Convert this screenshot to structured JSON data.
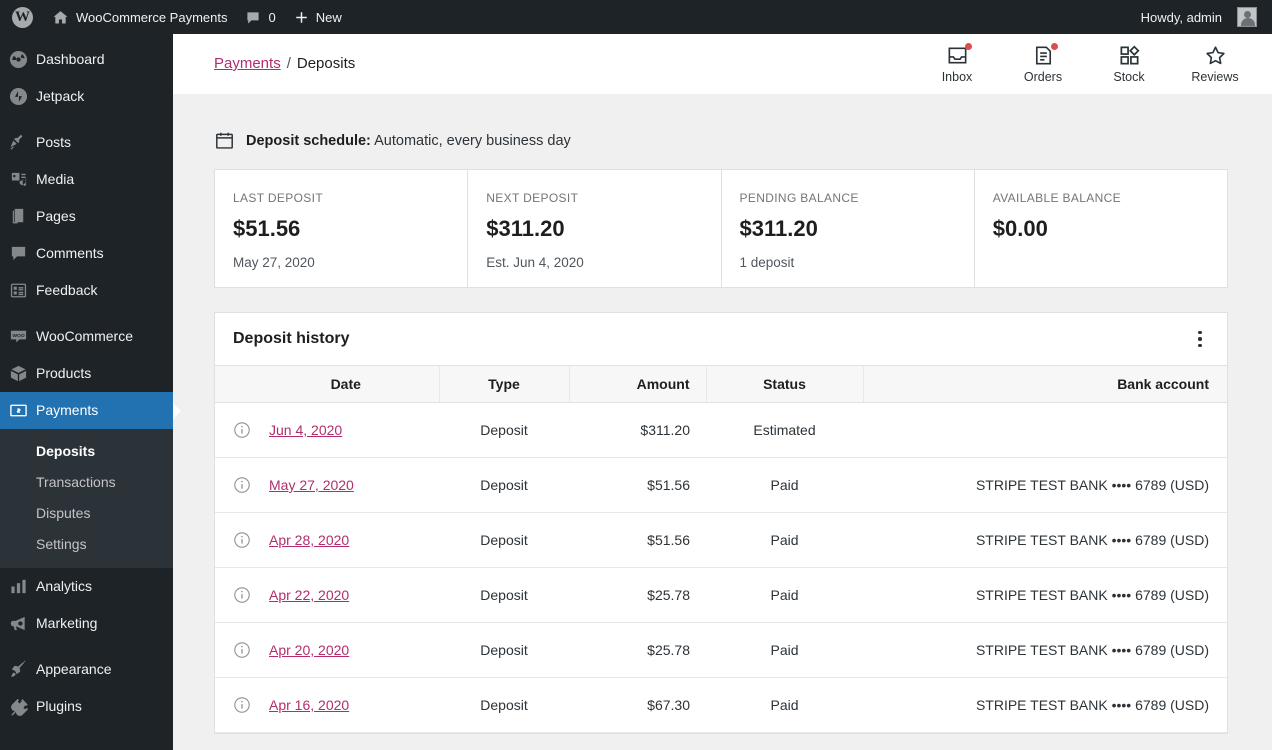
{
  "adminbar": {
    "wp_logo": "wordpress-logo",
    "site_name": "WooCommerce Payments",
    "comments_count": "0",
    "new_label": "New",
    "howdy": "Howdy, admin"
  },
  "sidebar": {
    "items": [
      {
        "label": "Dashboard",
        "icon": "dashboard-icon",
        "current": false
      },
      {
        "label": "Jetpack",
        "icon": "jetpack-icon",
        "current": false
      },
      {
        "label": "Posts",
        "icon": "pin-icon",
        "current": false
      },
      {
        "label": "Media",
        "icon": "media-icon",
        "current": false
      },
      {
        "label": "Pages",
        "icon": "pages-icon",
        "current": false
      },
      {
        "label": "Comments",
        "icon": "comment-icon",
        "current": false
      },
      {
        "label": "Feedback",
        "icon": "feedback-icon",
        "current": false
      },
      {
        "label": "WooCommerce",
        "icon": "woocommerce-icon",
        "current": false
      },
      {
        "label": "Products",
        "icon": "products-icon",
        "current": false
      },
      {
        "label": "Payments",
        "icon": "payments-icon",
        "current": true
      },
      {
        "label": "Analytics",
        "icon": "analytics-icon",
        "current": false
      },
      {
        "label": "Marketing",
        "icon": "marketing-icon",
        "current": false
      },
      {
        "label": "Appearance",
        "icon": "appearance-icon",
        "current": false
      },
      {
        "label": "Plugins",
        "icon": "plugins-icon",
        "current": false
      }
    ],
    "submenu": [
      {
        "label": "Deposits",
        "current": true
      },
      {
        "label": "Transactions",
        "current": false
      },
      {
        "label": "Disputes",
        "current": false
      },
      {
        "label": "Settings",
        "current": false
      }
    ]
  },
  "header": {
    "breadcrumb_link": "Payments",
    "breadcrumb_separator": "/",
    "breadcrumb_current": "Deposits",
    "nav": [
      {
        "label": "Inbox",
        "icon": "inbox-icon",
        "badge": true
      },
      {
        "label": "Orders",
        "icon": "orders-icon",
        "badge": true
      },
      {
        "label": "Stock",
        "icon": "stock-icon",
        "badge": false
      },
      {
        "label": "Reviews",
        "icon": "star-icon",
        "badge": false
      }
    ]
  },
  "schedule": {
    "icon": "calendar-icon",
    "label": "Deposit schedule:",
    "value": "Automatic, every business day"
  },
  "summary": [
    {
      "label": "LAST DEPOSIT",
      "value": "$51.56",
      "sub": "May 27, 2020"
    },
    {
      "label": "NEXT DEPOSIT",
      "value": "$311.20",
      "sub": "Est. Jun 4, 2020"
    },
    {
      "label": "PENDING BALANCE",
      "value": "$311.20",
      "sub": "1 deposit"
    },
    {
      "label": "AVAILABLE BALANCE",
      "value": "$0.00",
      "sub": ""
    }
  ],
  "history": {
    "title": "Deposit history",
    "menu_icon": "ellipsis-vertical-icon",
    "columns": [
      "",
      "Date",
      "Type",
      "Amount",
      "Status",
      "Bank account"
    ],
    "rows": [
      {
        "info": "info-icon",
        "date": "Jun 4, 2020",
        "type": "Deposit",
        "amount": "$311.20",
        "status": "Estimated",
        "bank": ""
      },
      {
        "info": "info-icon",
        "date": "May 27, 2020",
        "type": "Deposit",
        "amount": "$51.56",
        "status": "Paid",
        "bank": "STRIPE TEST BANK •••• 6789 (USD)"
      },
      {
        "info": "info-icon",
        "date": "Apr 28, 2020",
        "type": "Deposit",
        "amount": "$51.56",
        "status": "Paid",
        "bank": "STRIPE TEST BANK •••• 6789 (USD)"
      },
      {
        "info": "info-icon",
        "date": "Apr 22, 2020",
        "type": "Deposit",
        "amount": "$25.78",
        "status": "Paid",
        "bank": "STRIPE TEST BANK •••• 6789 (USD)"
      },
      {
        "info": "info-icon",
        "date": "Apr 20, 2020",
        "type": "Deposit",
        "amount": "$25.78",
        "status": "Paid",
        "bank": "STRIPE TEST BANK •••• 6789 (USD)"
      },
      {
        "info": "info-icon",
        "date": "Apr 16, 2020",
        "type": "Deposit",
        "amount": "$67.30",
        "status": "Paid",
        "bank": "STRIPE TEST BANK •••• 6789 (USD)"
      }
    ]
  },
  "colors": {
    "admin_dark": "#1d2327",
    "submenu_bg": "#2c3338",
    "accent_blue": "#2271b1",
    "link_pink": "#b32d6e",
    "badge_red": "#d94f4f",
    "page_bg": "#f0f0f1"
  }
}
